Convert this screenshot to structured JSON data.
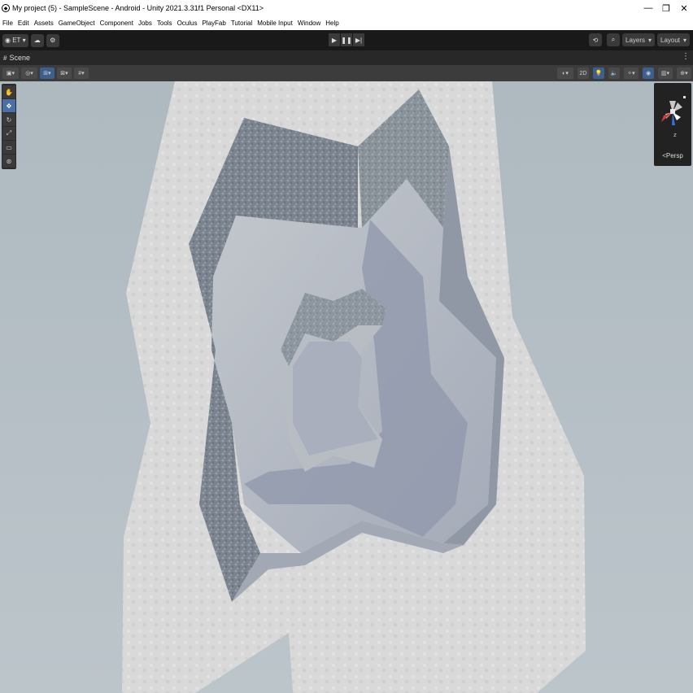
{
  "window": {
    "title": "My project (5) - SampleScene - Android - Unity 2021.3.31f1 Personal <DX11>",
    "controls": [
      "—",
      "❐",
      "✕"
    ]
  },
  "menu": [
    "File",
    "Edit",
    "Assets",
    "GameObject",
    "Component",
    "Jobs",
    "Tools",
    "Oculus",
    "PlayFab",
    "Tutorial",
    "Mobile Input",
    "Window",
    "Help"
  ],
  "toolbar": {
    "account": "ET",
    "layers": "Layers",
    "layout": "Layout"
  },
  "scene_tab": {
    "label": "Scene"
  },
  "scene_toolbar": {
    "mode_2d": "2D"
  },
  "gizmo": {
    "projection": "Persp",
    "axis_z": "z"
  }
}
